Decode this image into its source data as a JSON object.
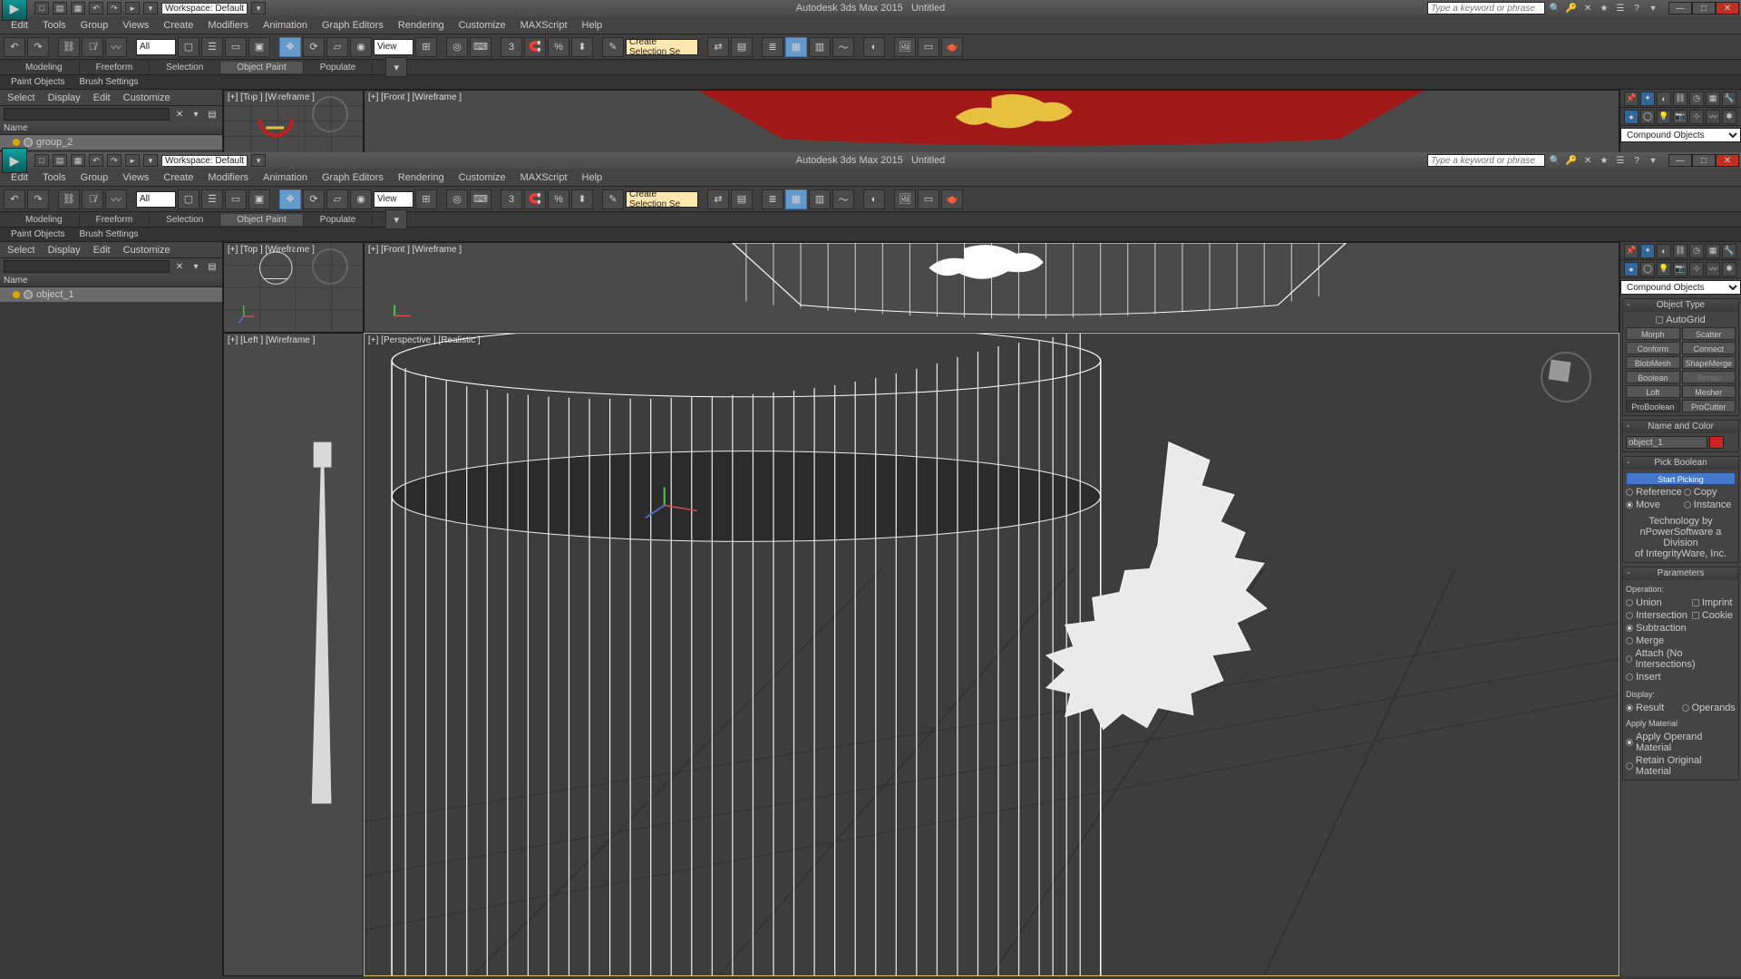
{
  "app": {
    "title": "Autodesk 3ds Max 2015",
    "doc": "Untitled",
    "workspace_label": "Workspace: Default",
    "search_placeholder": "Type a keyword or phrase"
  },
  "menus": [
    "Edit",
    "Tools",
    "Group",
    "Views",
    "Create",
    "Modifiers",
    "Animation",
    "Graph Editors",
    "Rendering",
    "Customize",
    "MAXScript",
    "Help"
  ],
  "toolbar": {
    "sel_filter": "All",
    "ref_coord": "View",
    "sel_set": "Create Selection Se"
  },
  "ribbon": {
    "tabs": [
      "Modeling",
      "Freeform",
      "Selection",
      "Object Paint",
      "Populate"
    ],
    "active": "Object Paint",
    "subtabs": [
      "Paint Objects",
      "Brush Settings"
    ]
  },
  "scene_explorer": {
    "menu": [
      "Select",
      "Display",
      "Edit",
      "Customize"
    ],
    "header": "Name",
    "item_top": "group_2",
    "item_bottom": "object_1"
  },
  "viewports": {
    "top": "[+] [Top ] [Wireframe ]",
    "front": "[+] [Front ] [Wireframe ]",
    "left": "[+] [Left ] [Wireframe ]",
    "persp": "[+] [Perspective ] [Realistic ]"
  },
  "cmd": {
    "category": "Compound Objects",
    "rollouts": {
      "object_type": {
        "title": "Object Type",
        "autogrid": "AutoGrid",
        "buttons": [
          "Morph",
          "Scatter",
          "Conform",
          "Connect",
          "BlobMesh",
          "ShapeMerge",
          "Boolean",
          "Terrain",
          "Loft",
          "Mesher",
          "ProBoolean",
          "ProCutter"
        ]
      },
      "name_color": {
        "title": "Name and Color",
        "name": "object_1"
      },
      "pick_boolean": {
        "title": "Pick Boolean",
        "button": "Start Picking",
        "options": [
          "Reference",
          "Copy",
          "Move",
          "Instance"
        ],
        "tech1": "Technology by",
        "tech2": "nPowerSoftware a Division",
        "tech3": "of IntegrityWare, Inc."
      },
      "parameters": {
        "title": "Parameters",
        "operation_label": "Operation:",
        "ops": [
          "Union",
          "Intersection",
          "Subtraction",
          "Merge",
          "Attach (No Intersections)",
          "Insert"
        ],
        "imprint": "Imprint",
        "cookie": "Cookie",
        "display_label": "Display:",
        "display_opts": [
          "Result",
          "Operands"
        ],
        "apply_mat_label": "Apply Material",
        "apply_mat_opts": [
          "Apply Operand Material",
          "Retain Original Material"
        ]
      }
    }
  }
}
